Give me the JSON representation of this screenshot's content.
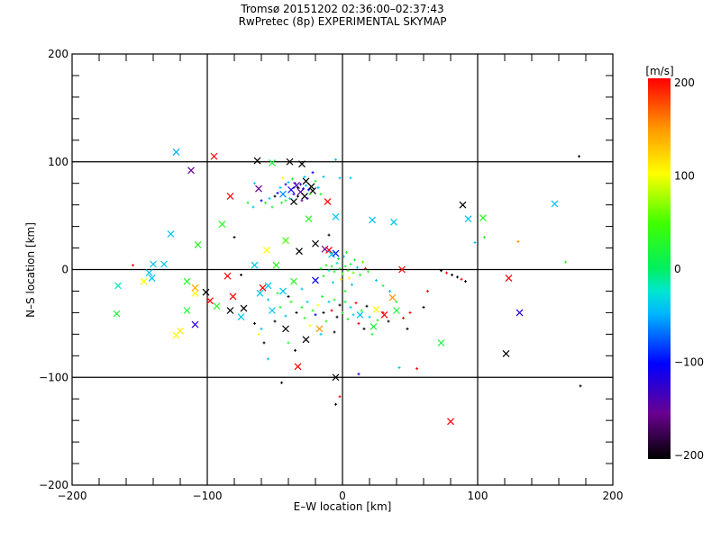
{
  "chart_data": {
    "type": "scatter",
    "title": "Tromsø 20151202 02:36:00–02:37:43",
    "subtitle": "RwPretec (8p) EXPERIMENTAL SKYMAP",
    "xlabel": "E–W location [km]",
    "ylabel": "N–S location [km]",
    "xlim": [
      -200,
      200
    ],
    "ylim": [
      -200,
      200
    ],
    "xticks": [
      "−200",
      "−100",
      "0",
      "100",
      "200"
    ],
    "yticks": [
      "−200",
      "−100",
      "0",
      "100",
      "200"
    ],
    "tick_values": [
      -200,
      -100,
      0,
      100,
      200
    ],
    "grid": true,
    "colorbar": {
      "label": "[m/s]",
      "range": [
        -200,
        200
      ],
      "ticks": [
        "200",
        "100",
        "0",
        "−100",
        "−200"
      ],
      "tick_values": [
        200,
        100,
        0,
        -100,
        -200
      ],
      "colormap": "black-purple-blue-cyan-green-yellow-red"
    },
    "series": [
      {
        "name": "large-markers",
        "marker": "x",
        "points": [
          [
            -123,
            109,
            -50
          ],
          [
            -112,
            92,
            -150
          ],
          [
            -95,
            105,
            200
          ],
          [
            -63,
            101,
            -200
          ],
          [
            -52,
            99,
            20
          ],
          [
            -62,
            75,
            -150
          ],
          [
            -83,
            68,
            200
          ],
          [
            -89,
            42,
            30
          ],
          [
            -127,
            33,
            -40
          ],
          [
            -107,
            23,
            30
          ],
          [
            -166,
            -15,
            -20
          ],
          [
            -167,
            -41,
            20
          ],
          [
            -140,
            5,
            -40
          ],
          [
            -132,
            5,
            -40
          ],
          [
            -143,
            -3,
            -40
          ],
          [
            -141,
            -8,
            -40
          ],
          [
            -147,
            -11,
            100
          ],
          [
            -115,
            -11,
            30
          ],
          [
            -109,
            -22,
            100
          ],
          [
            -109,
            -17,
            140
          ],
          [
            -101,
            -21,
            -200
          ],
          [
            -98,
            -29,
            200
          ],
          [
            -85,
            -6,
            200
          ],
          [
            -81,
            -25,
            200
          ],
          [
            -115,
            -38,
            20
          ],
          [
            -109,
            -51,
            -120
          ],
          [
            -120,
            -57,
            110
          ],
          [
            -123,
            -61,
            100
          ],
          [
            -93,
            -34,
            30
          ],
          [
            -75,
            -44,
            -40
          ],
          [
            -73,
            -36,
            -200
          ],
          [
            -65,
            4,
            -40
          ],
          [
            -59,
            -17,
            200
          ],
          [
            -61,
            -22,
            -40
          ],
          [
            -56,
            18,
            100
          ],
          [
            -42,
            27,
            50
          ],
          [
            -32,
            17,
            -200
          ],
          [
            -49,
            4,
            30
          ],
          [
            -36,
            -11,
            30
          ],
          [
            -13,
            19,
            -150
          ],
          [
            -10,
            18,
            200
          ],
          [
            -20,
            24,
            -200
          ],
          [
            -25,
            47,
            30
          ],
          [
            -5,
            49,
            -40
          ],
          [
            -11,
            63,
            200
          ],
          [
            -23,
            77,
            -200
          ],
          [
            -39,
            100,
            -200
          ],
          [
            -30,
            98,
            -200
          ],
          [
            -27,
            82,
            -200
          ],
          [
            -34,
            78,
            -130
          ],
          [
            -38,
            74,
            -110
          ],
          [
            -31,
            72,
            -150
          ],
          [
            -28,
            68,
            -200
          ],
          [
            -22,
            73,
            -200
          ],
          [
            -36,
            63,
            -200
          ],
          [
            -44,
            70,
            -60
          ],
          [
            22,
            46,
            -40
          ],
          [
            38,
            44,
            -40
          ],
          [
            44,
            0,
            200
          ],
          [
            89,
            60,
            -200
          ],
          [
            93,
            47,
            -40
          ],
          [
            104,
            48,
            30
          ],
          [
            157,
            61,
            -40
          ],
          [
            123,
            -8,
            200
          ],
          [
            131,
            -40,
            -120
          ],
          [
            121,
            -78,
            -200
          ],
          [
            73,
            -68,
            20
          ],
          [
            80,
            -141,
            200
          ],
          [
            -5,
            -100,
            -200
          ],
          [
            -33,
            -90,
            200
          ],
          [
            23,
            -53,
            20
          ],
          [
            -44,
            -20,
            -40
          ],
          [
            -27,
            -65,
            -200
          ],
          [
            -17,
            -55,
            150
          ],
          [
            -20,
            -10,
            -100
          ],
          [
            -8,
            14,
            -40
          ],
          [
            -5,
            15,
            -90
          ],
          [
            40,
            -38,
            20
          ],
          [
            37,
            -26,
            150
          ],
          [
            -52,
            -38,
            -40
          ],
          [
            -42,
            -55,
            -200
          ],
          [
            13,
            -42,
            -40
          ],
          [
            25,
            -37,
            100
          ],
          [
            -83,
            -38,
            -200
          ],
          [
            -55,
            -15,
            -40
          ],
          [
            31,
            -42,
            200
          ]
        ]
      },
      {
        "name": "small-markers",
        "marker": "+",
        "points": [
          [
            175,
            105,
            -200
          ],
          [
            176,
            -108,
            -200
          ],
          [
            130,
            26,
            150
          ],
          [
            165,
            7,
            20
          ],
          [
            -155,
            4,
            200
          ],
          [
            -45,
            -105,
            -200
          ],
          [
            -2,
            -118,
            200
          ],
          [
            12,
            -97,
            -100
          ],
          [
            55,
            -92,
            200
          ],
          [
            42,
            -91,
            -40
          ],
          [
            73,
            -1,
            -200
          ],
          [
            77,
            -3,
            200
          ],
          [
            81,
            -5,
            -200
          ],
          [
            85,
            -7,
            -200
          ],
          [
            88,
            -9,
            200
          ],
          [
            91,
            -11,
            -200
          ],
          [
            63,
            -20,
            200
          ],
          [
            105,
            30,
            30
          ],
          [
            98,
            25,
            -40
          ],
          [
            -5,
            -125,
            -200
          ],
          [
            -58,
            -68,
            -200
          ],
          [
            -62,
            -60,
            100
          ],
          [
            -55,
            -83,
            -40
          ],
          [
            -40,
            -68,
            20
          ],
          [
            -35,
            -75,
            -200
          ],
          [
            6,
            85,
            -40
          ],
          [
            -5,
            102,
            -40
          ],
          [
            -2,
            85,
            -40
          ],
          [
            -10,
            32,
            -200
          ],
          [
            -75,
            -5,
            -200
          ],
          [
            -80,
            30,
            -200
          ],
          [
            -65,
            80,
            -40
          ],
          [
            -70,
            62,
            20
          ],
          [
            -66,
            58,
            -40
          ],
          [
            -60,
            64,
            -100
          ],
          [
            -57,
            62,
            30
          ],
          [
            -54,
            66,
            -40
          ],
          [
            -50,
            68,
            -200
          ],
          [
            -48,
            71,
            -110
          ],
          [
            -46,
            76,
            -40
          ],
          [
            -42,
            79,
            -120
          ],
          [
            -40,
            81,
            -40
          ],
          [
            -37,
            84,
            20
          ],
          [
            -35,
            80,
            -150
          ],
          [
            -33,
            76,
            -200
          ],
          [
            -31,
            79,
            -130
          ],
          [
            -29,
            75,
            -110
          ],
          [
            -27,
            78,
            -40
          ],
          [
            -25,
            74,
            -100
          ],
          [
            -24,
            70,
            30
          ],
          [
            -26,
            66,
            -130
          ],
          [
            -30,
            64,
            -150
          ],
          [
            -33,
            68,
            -200
          ],
          [
            -36,
            70,
            -100
          ],
          [
            -39,
            66,
            -40
          ],
          [
            -42,
            64,
            20
          ],
          [
            -45,
            62,
            30
          ],
          [
            -28,
            86,
            -40
          ],
          [
            -22,
            90,
            -100
          ],
          [
            -20,
            82,
            30
          ],
          [
            -18,
            76,
            -40
          ],
          [
            -16,
            70,
            20
          ],
          [
            -14,
            86,
            -40
          ],
          [
            -44,
            85,
            100
          ],
          [
            -52,
            58,
            20
          ],
          [
            -8,
            3,
            20
          ],
          [
            -6,
            -2,
            30
          ],
          [
            -4,
            6,
            -20
          ],
          [
            -2,
            1,
            20
          ],
          [
            0,
            -4,
            40
          ],
          [
            2,
            3,
            10
          ],
          [
            4,
            -1,
            30
          ],
          [
            6,
            5,
            20
          ],
          [
            8,
            -3,
            60
          ],
          [
            -10,
            -1,
            -20
          ],
          [
            -12,
            4,
            30
          ],
          [
            -3,
            10,
            20
          ],
          [
            1,
            12,
            -40
          ],
          [
            5,
            -8,
            100
          ],
          [
            9,
            9,
            20
          ],
          [
            11,
            2,
            -40
          ],
          [
            13,
            -5,
            30
          ],
          [
            15,
            7,
            50
          ],
          [
            -14,
            -6,
            30
          ],
          [
            -1,
            -9,
            110
          ],
          [
            3,
            16,
            20
          ],
          [
            -7,
            -12,
            -40
          ],
          [
            17,
            1,
            200
          ],
          [
            19,
            -2,
            30
          ],
          [
            -16,
            1,
            20
          ],
          [
            7,
            -14,
            -40
          ],
          [
            2,
            -20,
            30
          ],
          [
            -15,
            -25,
            20
          ],
          [
            -10,
            -30,
            -40
          ],
          [
            -6,
            -28,
            30
          ],
          [
            -2,
            -33,
            -200
          ],
          [
            2,
            -30,
            20
          ],
          [
            6,
            -35,
            -40
          ],
          [
            10,
            -31,
            200
          ],
          [
            14,
            -38,
            30
          ],
          [
            18,
            -34,
            -200
          ],
          [
            -18,
            -33,
            100
          ],
          [
            -22,
            -38,
            30
          ],
          [
            -26,
            -30,
            -40
          ],
          [
            -30,
            -35,
            20
          ],
          [
            -34,
            -40,
            -200
          ],
          [
            -28,
            -45,
            30
          ],
          [
            -20,
            -42,
            -100
          ],
          [
            -12,
            -48,
            30
          ],
          [
            -4,
            -44,
            -200
          ],
          [
            4,
            -46,
            20
          ],
          [
            12,
            -50,
            200
          ],
          [
            20,
            -44,
            -40
          ],
          [
            26,
            -47,
            30
          ],
          [
            30,
            -40,
            200
          ],
          [
            34,
            -48,
            -200
          ],
          [
            -38,
            -30,
            30
          ],
          [
            -42,
            -43,
            -40
          ],
          [
            -46,
            -35,
            20
          ],
          [
            -50,
            -48,
            -200
          ],
          [
            -8,
            -38,
            200
          ],
          [
            0,
            -40,
            30
          ],
          [
            8,
            -42,
            -40
          ],
          [
            -14,
            -40,
            -200
          ],
          [
            -24,
            -52,
            100
          ],
          [
            16,
            -55,
            -200
          ],
          [
            22,
            -60,
            20
          ],
          [
            -6,
            -58,
            -200
          ],
          [
            -16,
            -60,
            -40
          ],
          [
            45,
            -45,
            200
          ],
          [
            50,
            -40,
            200
          ],
          [
            40,
            -30,
            20
          ],
          [
            35,
            -20,
            -40
          ],
          [
            30,
            -15,
            20
          ],
          [
            25,
            -10,
            -40
          ],
          [
            -30,
            -18,
            -40
          ],
          [
            -40,
            -25,
            -200
          ],
          [
            -48,
            -22,
            30
          ],
          [
            -55,
            -28,
            -40
          ],
          [
            60,
            -35,
            -200
          ],
          [
            48,
            -55,
            -200
          ],
          [
            -65,
            -50,
            -200
          ],
          [
            -60,
            -55,
            -40
          ]
        ]
      }
    ]
  }
}
